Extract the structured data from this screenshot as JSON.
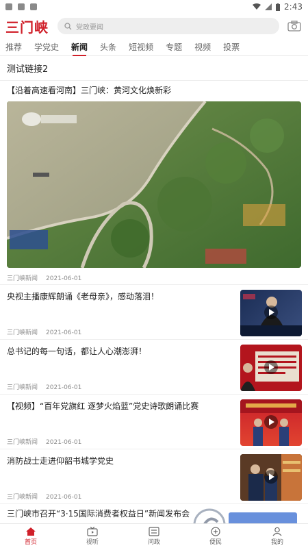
{
  "status_bar": {
    "time": "2:43"
  },
  "header": {
    "logo": "三门峡",
    "search_placeholder": "党政要闻"
  },
  "tabs": [
    {
      "label": "推荐",
      "active": false
    },
    {
      "label": "学党史",
      "active": false
    },
    {
      "label": "新闻",
      "active": true
    },
    {
      "label": "头条",
      "active": false
    },
    {
      "label": "短视频",
      "active": false
    },
    {
      "label": "专题",
      "active": false
    },
    {
      "label": "视频",
      "active": false
    },
    {
      "label": "投票",
      "active": false
    }
  ],
  "section_title": "测试链接2",
  "featured": {
    "title": "【沿着高速看河南】三门峡：黄河文化焕新彩",
    "source": "三门峡新闻",
    "date": "2021-06-01",
    "image_icon": "aerial-river-photo"
  },
  "news": [
    {
      "title": "央视主播康辉朗诵《老母亲》，感动落泪！",
      "source": "三门峡新闻",
      "date": "2021-06-01",
      "thumb_icon": "anchor-video-thumbnail"
    },
    {
      "title": "总书记的每一句话，都让人心潮澎湃！",
      "source": "三门峡新闻",
      "date": "2021-06-01",
      "thumb_icon": "red-poster-video-thumbnail"
    },
    {
      "title": "【视频】“百年党旗红 逐梦火焰蓝”党史诗歌朗诵比赛",
      "source": "三门峡新闻",
      "date": "2021-06-01",
      "thumb_icon": "stage-performance-thumbnail"
    },
    {
      "title": "消防战士走进仰韶书城学党史",
      "source": "三门峡新闻",
      "date": "2021-06-01",
      "thumb_icon": "bookstore-thumbnail"
    }
  ],
  "partial_item": {
    "title": "三门峡市召开“3·15国际消费者权益日”新闻发布会"
  },
  "bottom_nav": [
    {
      "label": "首页",
      "icon": "home-icon",
      "active": true
    },
    {
      "label": "视听",
      "icon": "tv-icon",
      "active": false
    },
    {
      "label": "问政",
      "icon": "wenzheng-icon",
      "active": false
    },
    {
      "label": "便民",
      "icon": "service-icon",
      "active": false
    },
    {
      "label": "我的",
      "icon": "profile-icon",
      "active": false
    }
  ],
  "colors": {
    "brand": "#d0202a",
    "text": "#222222",
    "meta": "#8a8a8a"
  }
}
